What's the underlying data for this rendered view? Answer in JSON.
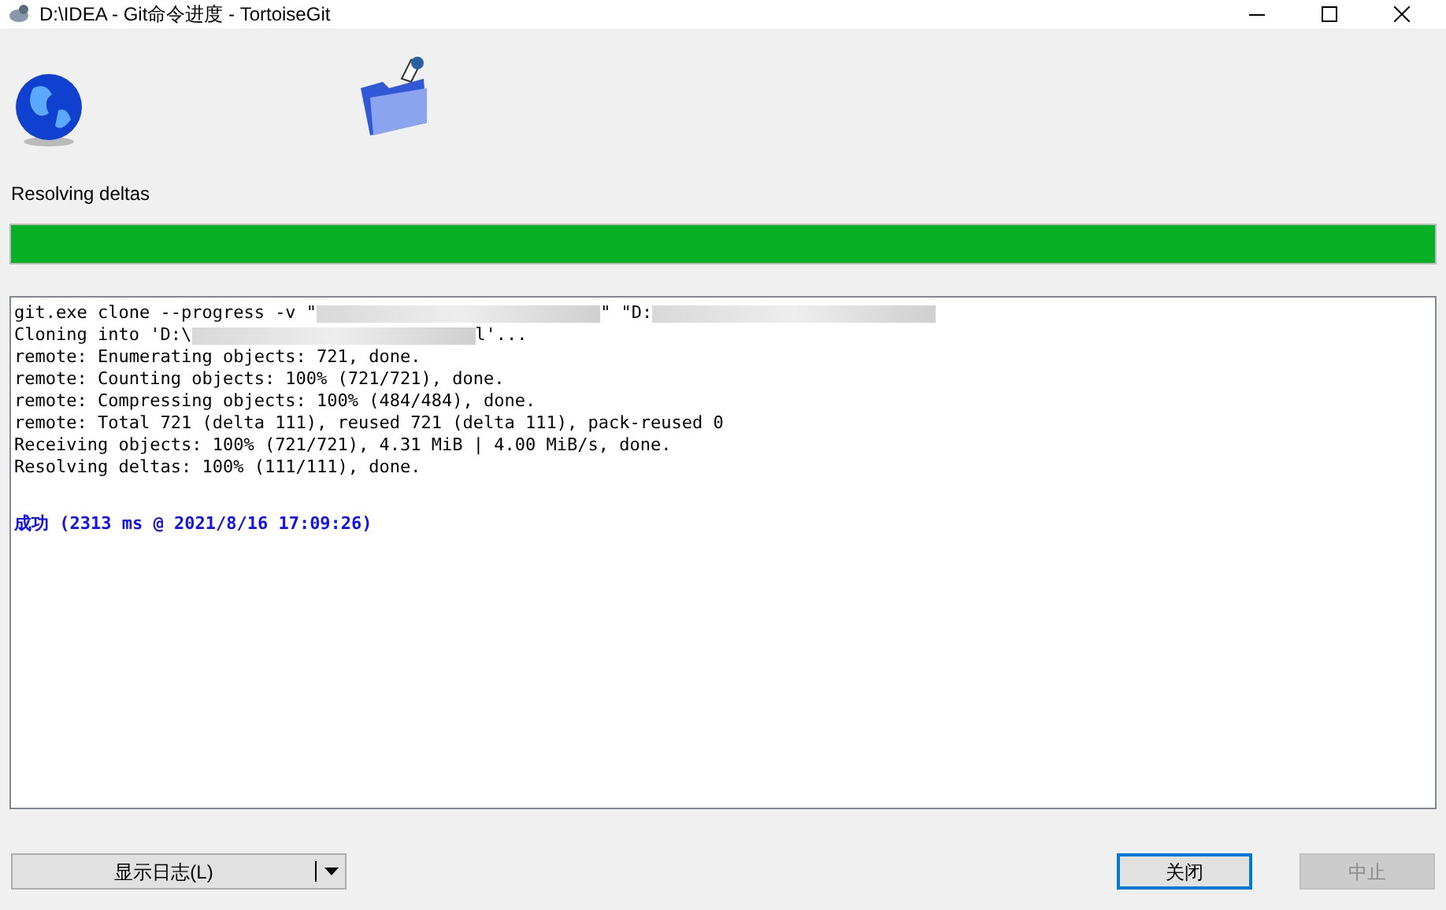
{
  "window": {
    "title": "D:\\IDEA - Git命令进度 - TortoiseGit"
  },
  "status": "Resolving deltas",
  "progress": {
    "level": 1
  },
  "log": [
    {
      "kind": "normal",
      "segments": [
        {
          "kind": "text",
          "text": "git.exe clone --progress -v \""
        },
        {
          "kind": "blur"
        },
        {
          "kind": "text",
          "text": "\" \"D:"
        },
        {
          "kind": "blur"
        }
      ]
    },
    {
      "kind": "normal",
      "segments": [
        {
          "kind": "text",
          "text": "Cloning into 'D:\\"
        },
        {
          "kind": "blur"
        },
        {
          "kind": "text",
          "text": "l'..."
        }
      ]
    },
    {
      "kind": "normal",
      "segments": [
        {
          "kind": "text",
          "text": "remote: Enumerating objects: 721, done."
        }
      ]
    },
    {
      "kind": "normal",
      "segments": [
        {
          "kind": "text",
          "text": "remote: Counting objects: 100% (721/721), done."
        }
      ]
    },
    {
      "kind": "normal",
      "segments": [
        {
          "kind": "text",
          "text": "remote: Compressing objects: 100% (484/484), done."
        }
      ]
    },
    {
      "kind": "normal",
      "segments": [
        {
          "kind": "text",
          "text": "remote: Total 721 (delta 111), reused 721 (delta 111), pack-reused 0"
        }
      ]
    },
    {
      "kind": "normal",
      "segments": [
        {
          "kind": "text",
          "text": "Receiving objects: 100% (721/721), 4.31 MiB | 4.00 MiB/s, done."
        }
      ]
    },
    {
      "kind": "normal",
      "segments": [
        {
          "kind": "text",
          "text": "Resolving deltas: 100% (111/111), done."
        }
      ]
    },
    {
      "kind": "blank"
    },
    {
      "kind": "success",
      "segments": [
        {
          "kind": "text",
          "text": "成功 (2313 ms @ 2021/8/16 17:09:26)"
        }
      ]
    }
  ],
  "buttons": {
    "show_log": {
      "label": "显示日志(L)"
    },
    "close": {
      "label": "关闭",
      "disabled": false
    },
    "abort": {
      "label": "中止",
      "disabled": true
    }
  }
}
